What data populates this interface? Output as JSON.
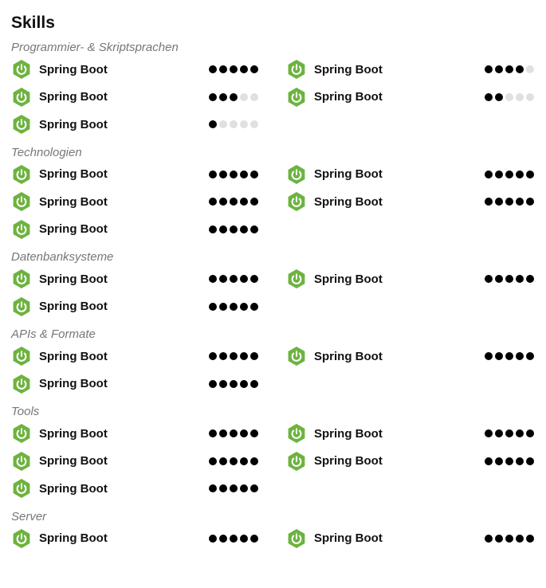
{
  "page": {
    "title": "Skills"
  },
  "colors": {
    "spring_green": "#6db33f",
    "dot_filled": "#000000",
    "dot_empty": "#e0e0e0"
  },
  "max_rating": 5,
  "sections": [
    {
      "title": "Programmier- & Skriptsprachen",
      "skills": [
        {
          "name": "Spring Boot",
          "rating": 5,
          "icon": "spring-boot-icon"
        },
        {
          "name": "Spring Boot",
          "rating": 4,
          "icon": "spring-boot-icon"
        },
        {
          "name": "Spring Boot",
          "rating": 3,
          "icon": "spring-boot-icon"
        },
        {
          "name": "Spring Boot",
          "rating": 2,
          "icon": "spring-boot-icon"
        },
        {
          "name": "Spring Boot",
          "rating": 1,
          "icon": "spring-boot-icon"
        }
      ]
    },
    {
      "title": "Technologien",
      "skills": [
        {
          "name": "Spring Boot",
          "rating": 5,
          "icon": "spring-boot-icon"
        },
        {
          "name": "Spring Boot",
          "rating": 5,
          "icon": "spring-boot-icon"
        },
        {
          "name": "Spring Boot",
          "rating": 5,
          "icon": "spring-boot-icon"
        },
        {
          "name": "Spring Boot",
          "rating": 5,
          "icon": "spring-boot-icon"
        },
        {
          "name": "Spring Boot",
          "rating": 5,
          "icon": "spring-boot-icon"
        }
      ]
    },
    {
      "title": "Datenbanksysteme",
      "skills": [
        {
          "name": "Spring Boot",
          "rating": 5,
          "icon": "spring-boot-icon"
        },
        {
          "name": "Spring Boot",
          "rating": 5,
          "icon": "spring-boot-icon"
        },
        {
          "name": "Spring Boot",
          "rating": 5,
          "icon": "spring-boot-icon"
        }
      ]
    },
    {
      "title": "APIs & Formate",
      "skills": [
        {
          "name": "Spring Boot",
          "rating": 5,
          "icon": "spring-boot-icon"
        },
        {
          "name": "Spring Boot",
          "rating": 5,
          "icon": "spring-boot-icon"
        },
        {
          "name": "Spring Boot",
          "rating": 5,
          "icon": "spring-boot-icon"
        }
      ]
    },
    {
      "title": "Tools",
      "skills": [
        {
          "name": "Spring Boot",
          "rating": 5,
          "icon": "spring-boot-icon"
        },
        {
          "name": "Spring Boot",
          "rating": 5,
          "icon": "spring-boot-icon"
        },
        {
          "name": "Spring Boot",
          "rating": 5,
          "icon": "spring-boot-icon"
        },
        {
          "name": "Spring Boot",
          "rating": 5,
          "icon": "spring-boot-icon"
        },
        {
          "name": "Spring Boot",
          "rating": 5,
          "icon": "spring-boot-icon"
        }
      ]
    },
    {
      "title": "Server",
      "skills": [
        {
          "name": "Spring Boot",
          "rating": 5,
          "icon": "spring-boot-icon"
        },
        {
          "name": "Spring Boot",
          "rating": 5,
          "icon": "spring-boot-icon"
        }
      ]
    }
  ]
}
